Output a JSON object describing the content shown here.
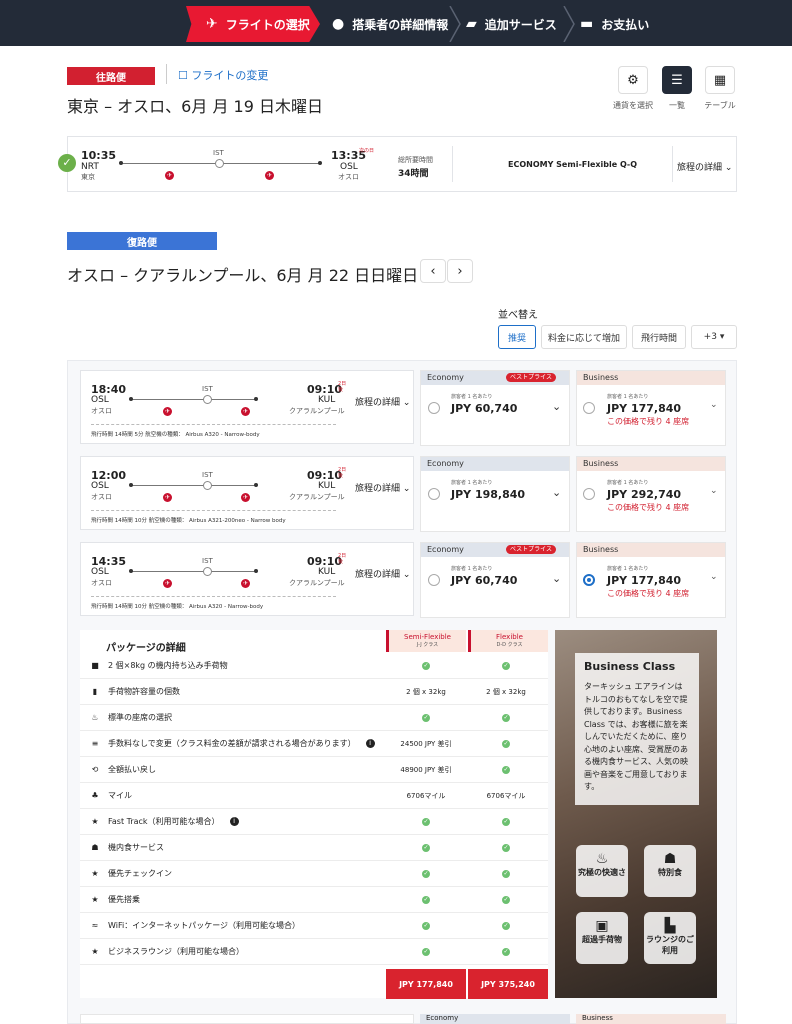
{
  "steps": [
    {
      "label": "フライトの選択",
      "icon": "airplane-icon",
      "active": true
    },
    {
      "label": "搭乗者の詳細情報",
      "icon": "person-icon",
      "active": false
    },
    {
      "label": "追加サービス",
      "icon": "tickets-icon",
      "active": false
    },
    {
      "label": "お支払い",
      "icon": "card-icon",
      "active": false
    }
  ],
  "outbound": {
    "tag": "往路便",
    "change_link": "フライトの変更",
    "title": "東京 – オスロ、6月 月 19 日木曜日",
    "view_labels": {
      "currency": "通貨を選択",
      "list": "一覧",
      "table": "テーブル"
    },
    "dep_time": "10:35",
    "dep_code": "NRT",
    "dep_city": "東京",
    "via": "IST",
    "arr_time": "13:35",
    "arr_suffix": "次の日",
    "arr_code": "OSL",
    "arr_city": "オスロ",
    "duration_label": "総所要時間",
    "duration": "34時間",
    "fare": "ECONOMY Semi-Flexible Q-Q",
    "details": "旅程の詳細"
  },
  "return": {
    "tag": "復路便",
    "title": "オスロ – クアラルンプール、6月 月 22 日日曜日"
  },
  "sort": {
    "label": "並べ替え",
    "options": [
      "推奨",
      "料金に応じて増加",
      "飛行時間",
      "+3"
    ]
  },
  "flights": [
    {
      "dep_time": "18:40",
      "dep_code": "OSL",
      "dep_city": "オスロ",
      "via": "IST",
      "arr_time": "09:10",
      "arr_suffix": "2日後",
      "arr_code": "KUL",
      "arr_city": "クアラルンプール",
      "details": "旅程の詳細",
      "meta": "飛行時間 14時間 5分  航空機の種類： Airbus A320 - Narrow-body",
      "economy_label": "Economy",
      "best_price": "ベストプライス",
      "per_person": "旅客者 1 名あたり",
      "economy_price": "JPY 60,740",
      "business_label": "Business",
      "business_price": "JPY 177,840",
      "seats_left": "この価格で残り 4 座席"
    },
    {
      "dep_time": "12:00",
      "dep_code": "OSL",
      "dep_city": "オスロ",
      "via": "IST",
      "arr_time": "09:10",
      "arr_suffix": "2日後",
      "arr_code": "KUL",
      "arr_city": "クアラルンプール",
      "details": "旅程の詳細",
      "meta": "飛行時間 14時間 10分  航空機の種類： Airbus A321-200neo - Narrow body",
      "economy_label": "Economy",
      "best_price": "",
      "per_person": "旅客者 1 名あたり",
      "economy_price": "JPY 198,840",
      "business_label": "Business",
      "business_price": "JPY 292,740",
      "seats_left": "この価格で残り 4 座席"
    },
    {
      "dep_time": "14:35",
      "dep_code": "OSL",
      "dep_city": "オスロ",
      "via": "IST",
      "arr_time": "09:10",
      "arr_suffix": "2日後",
      "arr_code": "KUL",
      "arr_city": "クアラルンプール",
      "details": "旅程の詳細",
      "meta": "飛行時間 14時間 10分  航空機の種類： Airbus A320 - Narrow-body",
      "economy_label": "Economy",
      "best_price": "ベストプライス",
      "per_person": "旅客者 1 名あたり",
      "economy_price": "JPY 60,740",
      "business_label": "Business",
      "business_price": "JPY 177,840",
      "seats_left": "この価格で残り 4 座席"
    }
  ],
  "package": {
    "title": "パッケージの詳細",
    "col1": "Semi-Flexible",
    "col1_sub": "J-J クラス",
    "col2": "Flexible",
    "col2_sub": "D-D クラス",
    "rows": [
      {
        "label": "2 個×8kg の機内持ち込み手荷物",
        "icon": "briefcase-icon",
        "c1": "",
        "c2": "",
        "info": false
      },
      {
        "label": "手荷物許容量の個数",
        "icon": "luggage-icon",
        "c1": "2 個 x 32kg",
        "c2": "2 個 x 32kg",
        "info": false
      },
      {
        "label": "標準の座席の選択",
        "icon": "seat-icon",
        "c1": "",
        "c2": "",
        "info": false
      },
      {
        "label": "手数料なしで変更（クラス料金の差額が請求される場合があります）",
        "icon": "change-icon",
        "c1": "24500 JPY 差引",
        "c2": "",
        "info": true
      },
      {
        "label": "全額払い戻し",
        "icon": "refund-icon",
        "c1": "48900 JPY 差引",
        "c2": "",
        "info": false
      },
      {
        "label": "マイル",
        "icon": "miles-icon",
        "c1": "6706マイル",
        "c2": "6706マイル",
        "info": false
      },
      {
        "label": "Fast Track（利用可能な場合）",
        "icon": "star-icon",
        "c1": "",
        "c2": "",
        "info": true
      },
      {
        "label": "機内食サービス",
        "icon": "meal-icon",
        "c1": "",
        "c2": "",
        "info": false
      },
      {
        "label": "優先チェックイン",
        "icon": "star-icon",
        "c1": "",
        "c2": "",
        "info": false
      },
      {
        "label": "優先搭乗",
        "icon": "star-icon",
        "c1": "",
        "c2": "",
        "info": false
      },
      {
        "label": "WiFi：インターネットパッケージ（利用可能な場合）",
        "icon": "wifi-icon",
        "c1": "",
        "c2": "",
        "info": false
      },
      {
        "label": "ビジネスラウンジ（利用可能な場合）",
        "icon": "star-icon",
        "c1": "",
        "c2": "",
        "info": false
      }
    ],
    "price1": "JPY 177,840",
    "price2": "JPY 375,240"
  },
  "promo": {
    "title": "Business Class",
    "body": "ターキッシュ エアラインはトルコのおもてなしを空で提供しております。Business Class では、お客様に旅を楽しんでいただくために、座り心地のよい座席、受賞歴のある機内食サービス、人気の映画や音楽をご用意しております。",
    "features": [
      "究極の快適さ",
      "特別食",
      "超過手荷物",
      "ラウンジのご利用"
    ]
  },
  "bottom_stub": {
    "economy": "Economy",
    "business": "Business"
  }
}
